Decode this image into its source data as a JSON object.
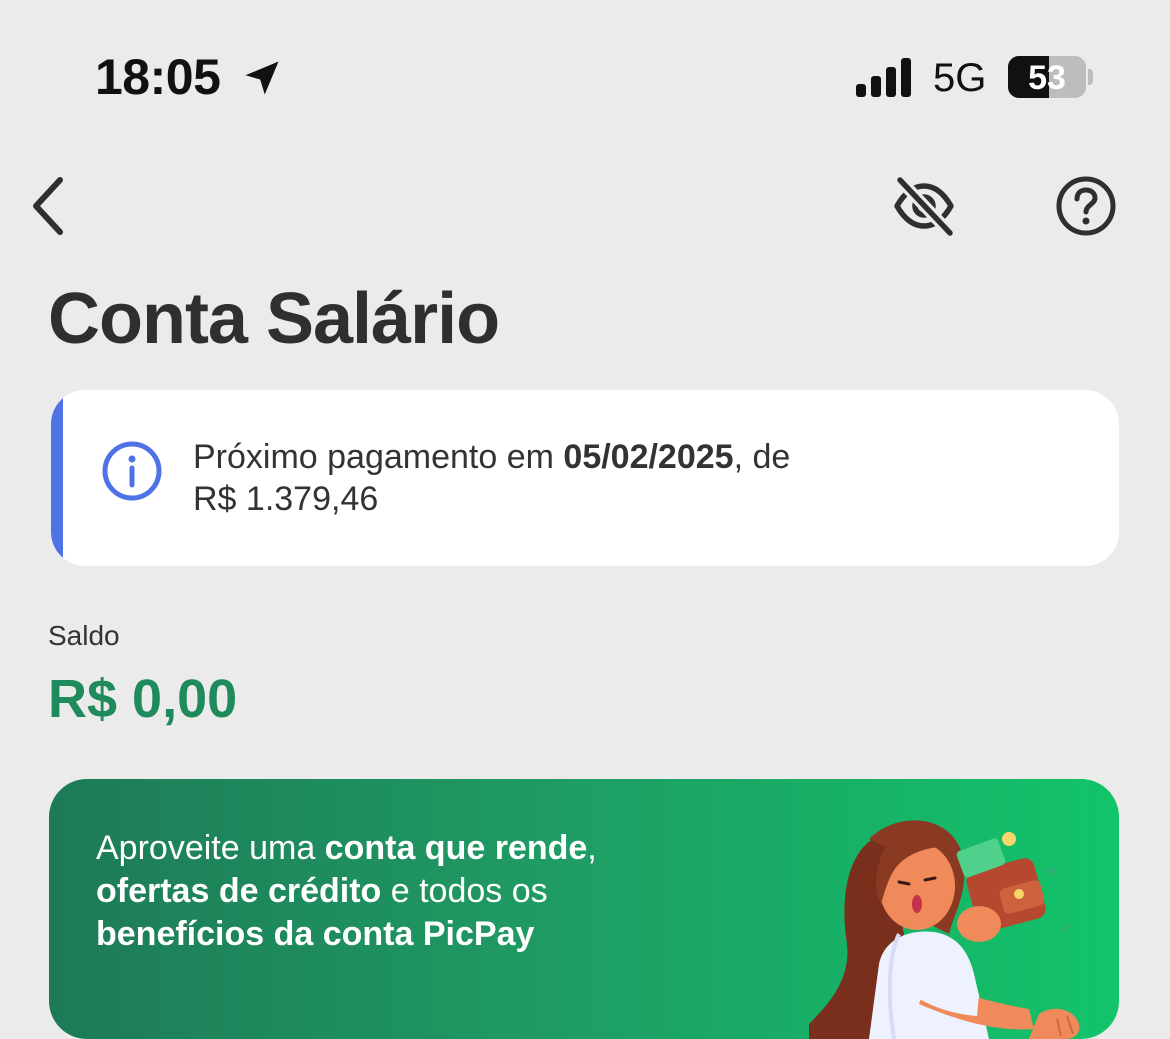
{
  "status_bar": {
    "time": "18:05",
    "network": "5G",
    "battery_percent": 53,
    "battery_text": "53",
    "icons": [
      "location-arrow-icon",
      "signal-bars-icon",
      "battery-icon"
    ]
  },
  "nav": {
    "icons": [
      "chevron-left-icon",
      "eye-off-icon",
      "question-circle-icon"
    ]
  },
  "page": {
    "title": "Conta Salário"
  },
  "info_card": {
    "icon": "info-circle-icon",
    "text_prefix": "Próximo pagamento em ",
    "date": "05/02/2025",
    "text_middle": ", de",
    "amount": "R$ 1.379,46",
    "accent_color": "#4f73e6"
  },
  "balance": {
    "label": "Saldo",
    "value": "R$ 0,00",
    "color": "#1f8a5b"
  },
  "promo": {
    "line1_regular": "Aproveite uma ",
    "line1_bold": "conta que rende",
    "line1_end": ",",
    "line2_bold": "ofertas de crédito",
    "line2_regular": " e todos os",
    "line3_bold": "benefícios da conta PicPay",
    "illustration": "woman-with-wallet-illustration",
    "gradient_colors": [
      "#1d7a57",
      "#12c46a"
    ]
  }
}
